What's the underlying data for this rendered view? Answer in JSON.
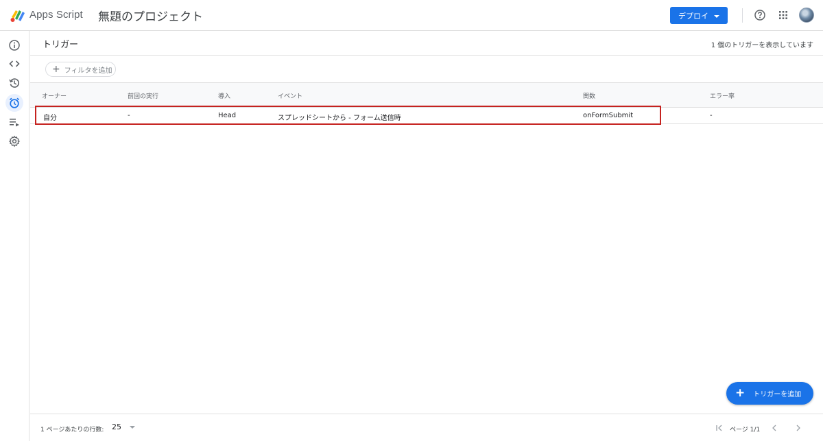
{
  "header": {
    "app_name": "Apps Script",
    "project_title": "無題のプロジェクト",
    "deploy_label": "デプロイ",
    "icons": [
      "help-icon",
      "apps-grid-icon",
      "avatar"
    ]
  },
  "rail": {
    "items": [
      {
        "name": "overview",
        "icon": "info-icon",
        "active": false
      },
      {
        "name": "editor",
        "icon": "code-icon",
        "active": false
      },
      {
        "name": "executions",
        "icon": "history-icon",
        "active": false
      },
      {
        "name": "triggers",
        "icon": "alarm-clock-icon",
        "active": true
      },
      {
        "name": "executions-log",
        "icon": "list-play-icon",
        "active": false
      },
      {
        "name": "settings",
        "icon": "gear-icon",
        "active": false
      }
    ]
  },
  "page": {
    "title": "トリガー",
    "count_text": "1 個のトリガーを表示しています",
    "filter_label": "フィルタを追加"
  },
  "table": {
    "columns": [
      "オーナー",
      "前回の実行",
      "導入",
      "イベント",
      "関数",
      "エラー率"
    ],
    "rows": [
      {
        "owner": "自分",
        "last_run": "-",
        "deployment": "Head",
        "event": "スプレッドシートから - フォーム送信時",
        "function": "onFormSubmit",
        "error_rate": "-"
      }
    ]
  },
  "fab_label": "トリガーを追加",
  "footer": {
    "rows_per_page_label": "1 ページあたりの行数:",
    "rows_per_page_value": "25",
    "page_text": "ページ 1/1"
  },
  "colors": {
    "accent": "#1a73e8",
    "highlight": "#c5221f",
    "active_rail_bg": "#e8f0fe"
  }
}
